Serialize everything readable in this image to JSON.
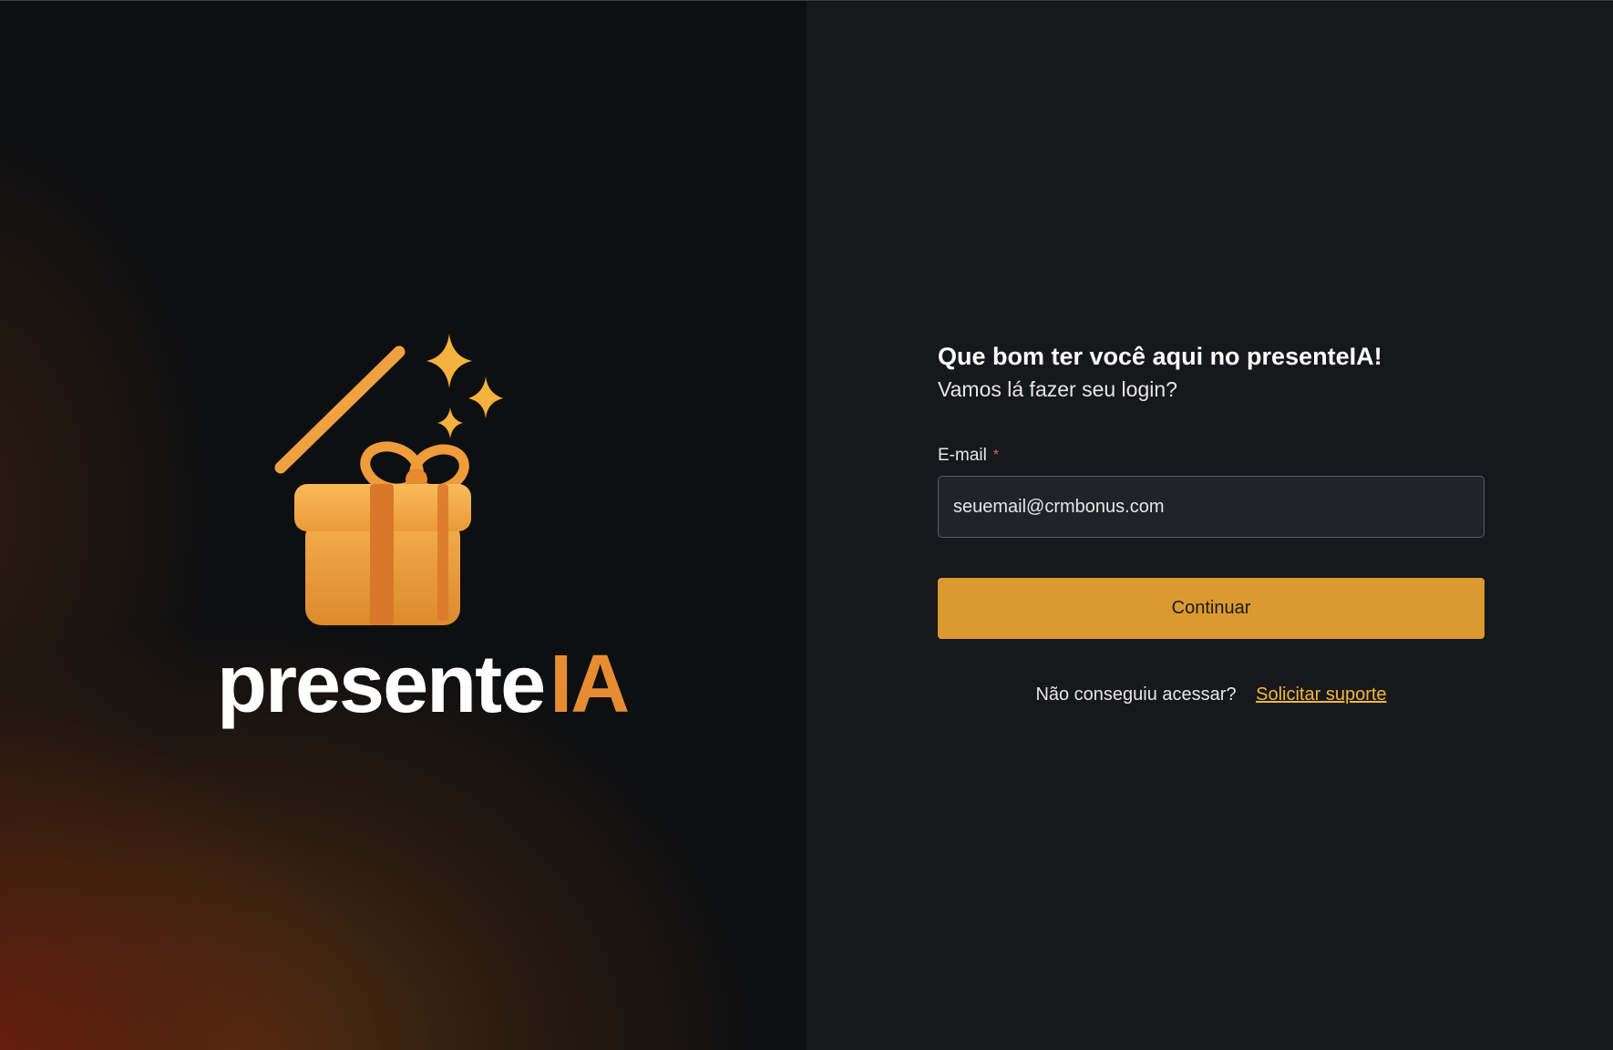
{
  "brand": {
    "logo_text_white": "presente",
    "logo_text_orange": "IA",
    "accent_color": "#e68d33",
    "illustration": "gift-box-with-magic-wand-icon"
  },
  "login": {
    "title": "Que bom ter você aqui no presenteIA!",
    "subtitle": "Vamos lá fazer seu login?",
    "email_label": "E-mail",
    "required_marker": "*",
    "email_placeholder": "seuemail@crmbonus.com",
    "continue_label": "Continuar",
    "button_color": "#db9a30",
    "help_text": "Não conseguiu acessar?",
    "support_link": "Solicitar suporte"
  }
}
